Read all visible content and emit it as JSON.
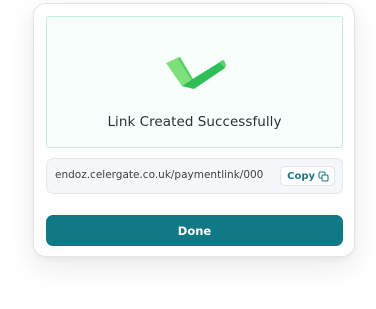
{
  "dialog": {
    "status_icon": "check-icon",
    "title": "Link Created Successfully",
    "link": {
      "url": "endoz.celergate.co.uk/paymentlink/000",
      "copy_label": "Copy",
      "copy_icon": "copy-icon"
    },
    "done_label": "Done"
  },
  "colors": {
    "primary": "#117985",
    "success_dark": "#2fbf57",
    "success_light": "#7fe07a",
    "panel_border": "#c4ecd9",
    "copy_text": "#1c7a86"
  }
}
